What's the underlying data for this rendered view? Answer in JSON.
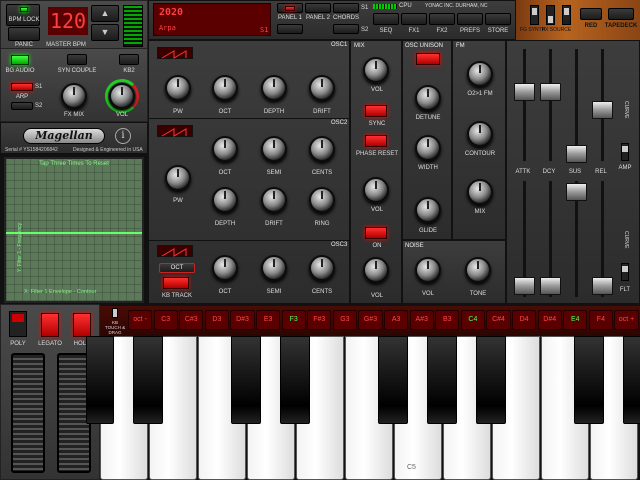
{
  "top": {
    "bpm_value": "120",
    "bpm_lock": "BPM LOCK",
    "panic": "PANIC",
    "master_bpm": "MASTER BPM",
    "preset_number": "2020",
    "preset_name": "Arpa",
    "preset_slot": "S1",
    "panel1": "PANEL 1",
    "panel2": "PANEL 2",
    "chords": "CHORDS",
    "s1": "S1",
    "s2": "S2",
    "cpu": "CPU",
    "company": "YONAC INC. DURHAM, NC",
    "tabs": [
      "SEQ",
      "FX1",
      "FX2",
      "PREFS",
      "STORE"
    ],
    "fx_switches": [
      "FG SYNTH",
      "FX SOURCE",
      "FX"
    ],
    "red": "RED",
    "tapedeck": "TAPEDECK"
  },
  "left": {
    "bg_audio": "BG AUDIO",
    "syn_couple": "SYN COUPLE",
    "kb2": "KB2",
    "arp_s1": "S1",
    "arp_label": "ARP",
    "arp_s2": "S2",
    "fx_mix": "FX MIX",
    "vol": "VOL",
    "logo": "Magellan",
    "serial": "Serial # YS1584206842",
    "designed": "Designed & Engineered in USA",
    "xy_top": "Tap Three Times To Reset",
    "xy_side": "Y: Filter 1 - Frequency",
    "xy_bottom": "X: Filter 1 Envelope - Contour"
  },
  "osc1": {
    "title": "OSC1",
    "knobs": [
      "PW",
      "OCT",
      "DEPTH",
      "DRIFT"
    ]
  },
  "osc2": {
    "title": "OSC2",
    "knobs": [
      "PW",
      "OCT",
      "SEMI",
      "CENTS",
      "DEPTH",
      "DRIFT",
      "RING"
    ]
  },
  "osc3": {
    "title": "OSC3",
    "oct": "OCT",
    "kb_track": "KB TRACK",
    "knobs": [
      "OCT",
      "SEMI",
      "CENTS"
    ]
  },
  "mix": {
    "title": "MIX",
    "vol1": "VOL",
    "sync": "SYNC",
    "phase_reset": "PHASE RESET",
    "vol2": "VOL",
    "on": "ON",
    "vol3": "VOL"
  },
  "unison": {
    "title": "OSC UNISON",
    "detune": "DETUNE",
    "width": "WIDTH",
    "glide": "GLIDE"
  },
  "fm": {
    "title": "FM",
    "o2o1": "O2>1 FM",
    "contour": "CONTOUR",
    "mix": "MIX"
  },
  "noise": {
    "title": "NOISE",
    "vol": "VOL",
    "tone": "TONE"
  },
  "env": {
    "labels": [
      "ATTK",
      "DCY",
      "SUS",
      "REL"
    ],
    "curve": "CURVE",
    "amp": "AMP",
    "flt": "FLT"
  },
  "keyboard": {
    "poly": "POLY",
    "legato": "LEGATO",
    "hold": "HOLD",
    "kb_touch": "KB TOUCH & DRAG",
    "notes": [
      "oct -",
      "C3",
      "C#3",
      "D3",
      "D#3",
      "E3",
      "F3",
      "F#3",
      "G3",
      "G#3",
      "A3",
      "A#3",
      "B3",
      "C4",
      "C#4",
      "D4",
      "D#4",
      "E4",
      "F4",
      "oct +"
    ],
    "c_label": "C5"
  },
  "colors": {
    "red_led": "#ff2020",
    "green_led": "#30ff30",
    "note_text": "#ff4848",
    "note_active": "#55ff55"
  }
}
